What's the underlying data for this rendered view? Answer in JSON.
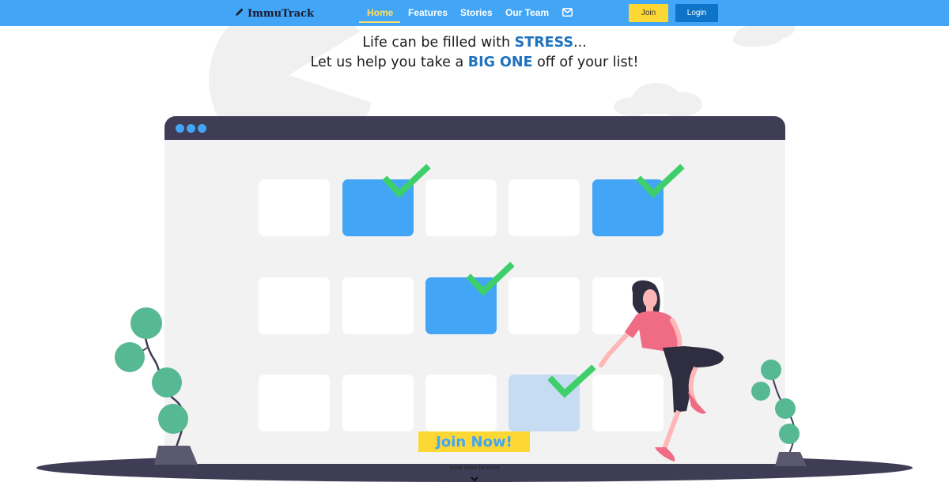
{
  "navbar": {
    "brand": "ImmuTrack",
    "brand_icon": "pencil-icon",
    "links": [
      {
        "label": "Home",
        "active": true
      },
      {
        "label": "Features",
        "active": false
      },
      {
        "label": "Stories",
        "active": false
      },
      {
        "label": "Our Team",
        "active": false
      }
    ],
    "contact_icon": "envelope-icon",
    "join_label": "Join",
    "login_label": "Login"
  },
  "hero": {
    "line1_prefix": "Life can be filled with ",
    "line1_accent": "STRESS",
    "line1_suffix": "...",
    "line2_prefix": "Let us help you take a ",
    "line2_accent": "BIG ONE",
    "line2_suffix": " off of your list!",
    "cta_label": "Join Now!",
    "scroll_hint": "scroll down for more"
  },
  "colors": {
    "primary": "#42a5f5",
    "accent_text": "#1e73be",
    "cta": "#fdd835",
    "login": "#0d74c7",
    "check": "#3ecf6a",
    "dark": "#3f3d56"
  }
}
